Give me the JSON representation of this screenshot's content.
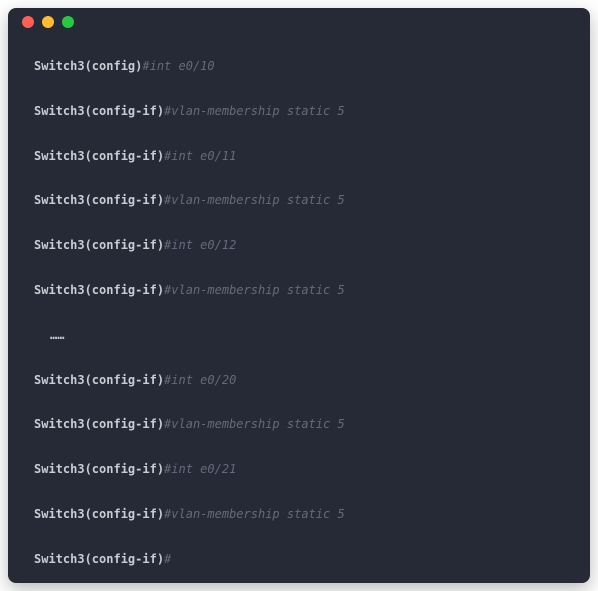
{
  "titlebar": {
    "dots": [
      "red",
      "yellow",
      "green"
    ]
  },
  "lines": [
    {
      "prompt": "Switch3(config)",
      "comment": "#int e0/10"
    },
    {
      "prompt": "Switch3(config-if)",
      "comment": "#vlan-membership static 5"
    },
    {
      "prompt": "Switch3(config-if)",
      "comment": "#int e0/11"
    },
    {
      "prompt": "Switch3(config-if)",
      "comment": "#vlan-membership static 5"
    },
    {
      "prompt": "Switch3(config-if)",
      "comment": "#int e0/12"
    },
    {
      "prompt": "Switch3(config-if)",
      "comment": "#vlan-membership static 5"
    },
    {
      "ellipsis": "……"
    },
    {
      "prompt": "Switch3(config-if)",
      "comment": "#int e0/20"
    },
    {
      "prompt": "Switch3(config-if)",
      "comment": "#vlan-membership static 5"
    },
    {
      "prompt": "Switch3(config-if)",
      "comment": "#int e0/21"
    },
    {
      "prompt": "Switch3(config-if)",
      "comment": "#vlan-membership static 5"
    },
    {
      "prompt": "Switch3(config-if)",
      "comment": "#"
    }
  ]
}
